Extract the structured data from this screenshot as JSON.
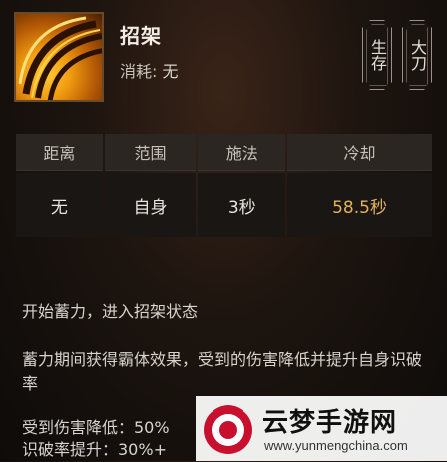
{
  "skill": {
    "name": "招架",
    "cost_label": "消耗:",
    "cost_value": "无",
    "tags": [
      "生存",
      "大刀"
    ]
  },
  "stats": {
    "headers": [
      "距离",
      "范围",
      "施法",
      "冷却"
    ],
    "values": [
      "无",
      "自身",
      "3秒",
      "58.5秒"
    ],
    "accent_color": "#e3b25b"
  },
  "description": {
    "line1": "开始蓄力，进入招架状态",
    "line2": "蓄力期间获得霸体效果，受到的伤害降低并提升自身识破率",
    "line3": "受到伤害降低：50%",
    "line4": "识破率提升：30%+"
  },
  "watermark": {
    "title": "云梦手游网",
    "url": "www.yunmengchina.com"
  }
}
